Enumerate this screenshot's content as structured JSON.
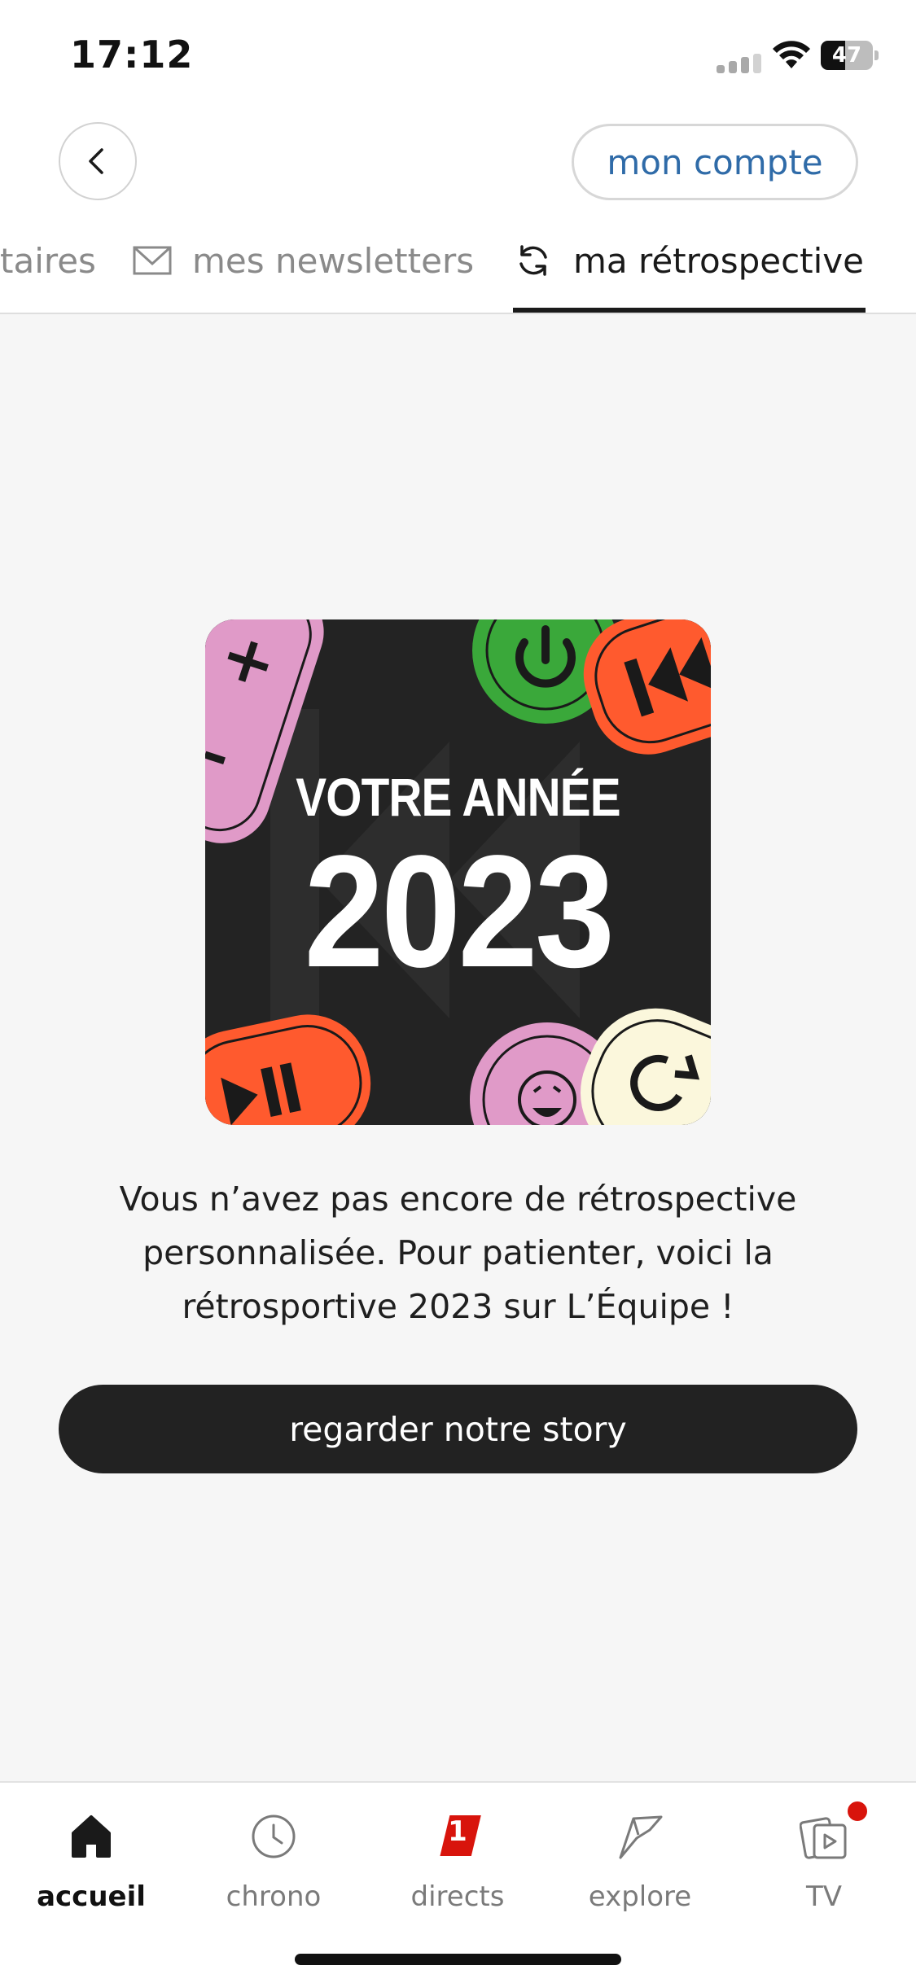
{
  "status_bar": {
    "time": "17:12",
    "battery_level": "47",
    "battery_fraction": 0.47,
    "icons": [
      "signal-icon",
      "wifi-icon",
      "battery-icon"
    ]
  },
  "header": {
    "back_icon": "chevron-left-icon",
    "account_label": "mon compte"
  },
  "tabs": [
    {
      "label": "taires",
      "icon": null,
      "active": false
    },
    {
      "label": "mes newsletters",
      "icon": "envelope-icon",
      "active": false
    },
    {
      "label": "ma rétrospective",
      "icon": "refresh-icon",
      "active": true
    }
  ],
  "artwork": {
    "subtitle": "VOTRE ANNÉE",
    "year": "2023"
  },
  "message": "Vous n’avez pas encore de rétrospective personnalisée. Pour patienter, voici la rétrosportive 2023 sur L’Équipe !",
  "cta_label": "regarder notre story",
  "tab_bar": [
    {
      "label": "accueil",
      "icon": "home-icon",
      "active": true
    },
    {
      "label": "chrono",
      "icon": "clock-icon",
      "active": false
    },
    {
      "label": "directs",
      "icon": "live-badge-icon",
      "active": false,
      "badge": "1"
    },
    {
      "label": "explore",
      "icon": "explore-icon",
      "active": false
    },
    {
      "label": "TV",
      "icon": "tv-icon",
      "active": false,
      "dot": true
    }
  ],
  "colors": {
    "accent_blue": "#2f6ba8",
    "live_red": "#d8140c",
    "dark": "#222222",
    "art_pink": "#e09ac8",
    "art_green": "#3aa83a",
    "art_orange": "#ff5a2e",
    "art_cream": "#fbf7dc"
  }
}
